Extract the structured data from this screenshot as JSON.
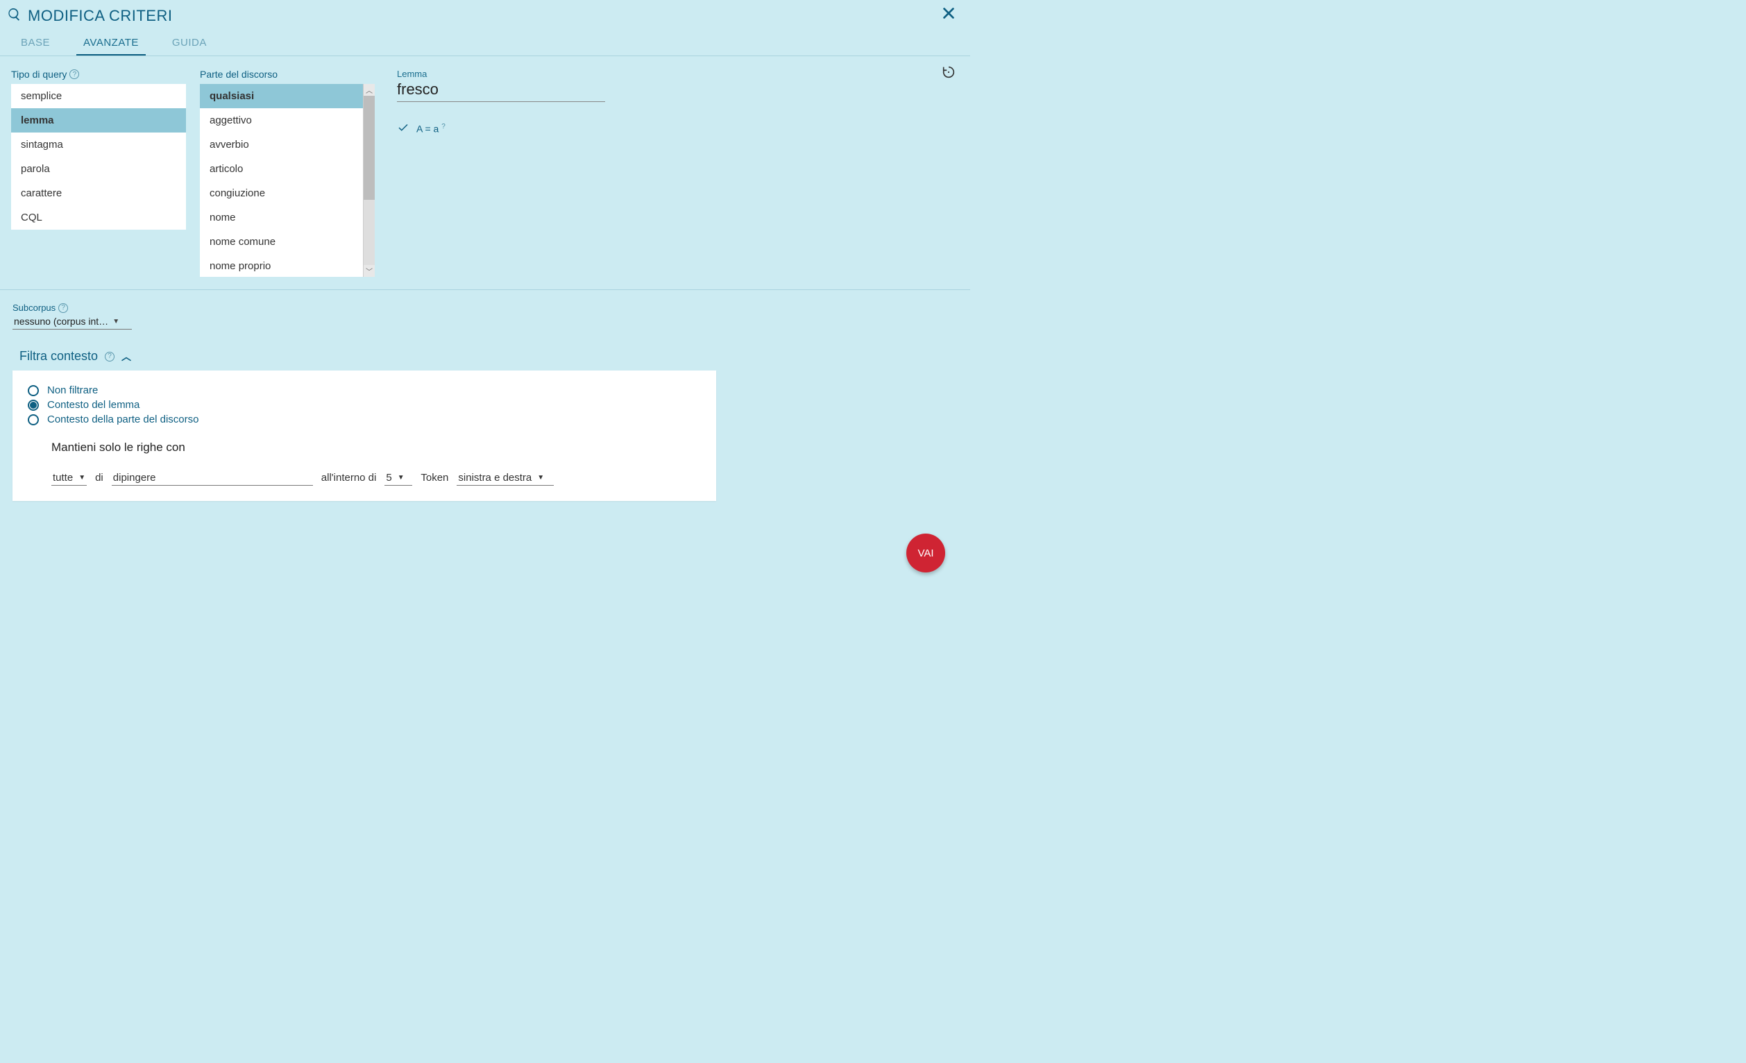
{
  "header": {
    "title": "MODIFICA CRITERI"
  },
  "tabs": {
    "base": "BASE",
    "advanced": "AVANZATE",
    "guide": "GUIDA",
    "active": "AVANZATE"
  },
  "query_type": {
    "label": "Tipo di query",
    "options": [
      "semplice",
      "lemma",
      "sintagma",
      "parola",
      "carattere",
      "CQL"
    ],
    "selected": "lemma"
  },
  "pos": {
    "label": "Parte del discorso",
    "options": [
      "qualsiasi",
      "aggettivo",
      "avverbio",
      "articolo",
      "congiuzione",
      "nome",
      "nome comune",
      "nome proprio"
    ],
    "selected": "qualsiasi"
  },
  "lemma_field": {
    "label": "Lemma",
    "value": "fresco"
  },
  "case_toggle": {
    "text": "A = a",
    "sup": "?"
  },
  "subcorpus": {
    "label": "Subcorpus",
    "value": "nessuno (corpus int…"
  },
  "filter": {
    "title": "Filtra contesto",
    "radios": {
      "none": "Non filtrare",
      "lemma": "Contesto del lemma",
      "pos": "Contesto della parte del discorso",
      "selected": "lemma"
    },
    "keep_text": "Mantieni solo le righe con",
    "controls": {
      "quantifier": "tutte",
      "of": "di",
      "value": "dipingere",
      "within": "all'interno di",
      "count": "5",
      "token": "Token",
      "side": "sinistra e destra"
    }
  },
  "fab": {
    "label": "VAI"
  }
}
